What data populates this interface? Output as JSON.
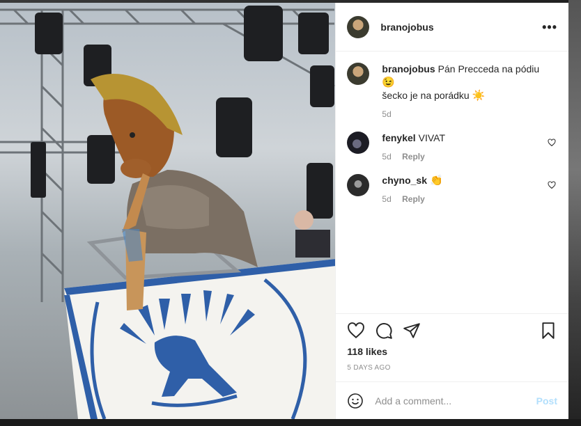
{
  "colors": {
    "text": "#262626",
    "muted": "#8e8e8e",
    "border": "#efefef",
    "post_disabled": "#b2dffc",
    "flag_blue": "#2f5fa8"
  },
  "post": {
    "author": "branojobus",
    "caption": "Pán Precceda na pódiu",
    "caption_line2": "šecko je na porádku",
    "caption_emoji1": "😉",
    "caption_emoji2": "☀️",
    "caption_age": "5d",
    "more_icon": "more-horizontal-icon"
  },
  "comments": [
    {
      "user": "fenykel",
      "text": "VIVAT",
      "emoji": "",
      "age": "5d",
      "reply": "Reply"
    },
    {
      "user": "chyno_sk",
      "text": "",
      "emoji": "👏",
      "age": "5d",
      "reply": "Reply"
    }
  ],
  "actions": {
    "likes": "118 likes",
    "date": "5 DAYS AGO",
    "icons": [
      "heart-icon",
      "comment-icon",
      "share-icon",
      "bookmark-icon"
    ]
  },
  "add_comment": {
    "placeholder": "Add a comment...",
    "post_label": "Post",
    "emoji_icon": "smiley-icon"
  }
}
